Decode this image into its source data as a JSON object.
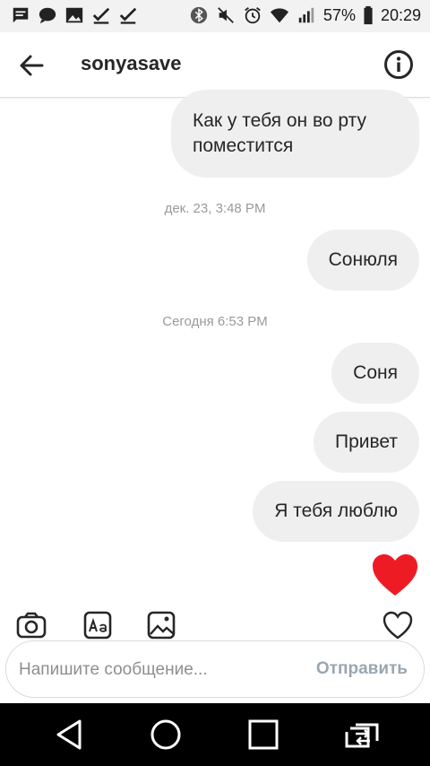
{
  "status_bar": {
    "battery": "57%",
    "time": "20:29",
    "left_icons": [
      "message-icon",
      "chat-bubble-icon",
      "image-icon",
      "check-icon",
      "check-icon"
    ],
    "right_icons": [
      "bluetooth-icon",
      "mute-icon",
      "alarm-icon",
      "wifi-icon",
      "signal-icon",
      "battery-icon"
    ]
  },
  "header": {
    "title": "sonyasave"
  },
  "messages": [
    {
      "text": "Как у тебя он во рту поместится"
    },
    {
      "timestamp": "дек. 23, 3:48 PM"
    },
    {
      "text": "Сонюля"
    },
    {
      "timestamp": "Сегодня 6:53 PM"
    },
    {
      "text": "Соня"
    },
    {
      "text": "Привет"
    },
    {
      "text": "Я тебя люблю"
    }
  ],
  "composer": {
    "placeholder": "Напишите сообщение...",
    "send_label": "Отправить"
  },
  "colors": {
    "heart": "#ed1c24",
    "bubble": "#efefef",
    "send_disabled": "#9aa6b0"
  }
}
